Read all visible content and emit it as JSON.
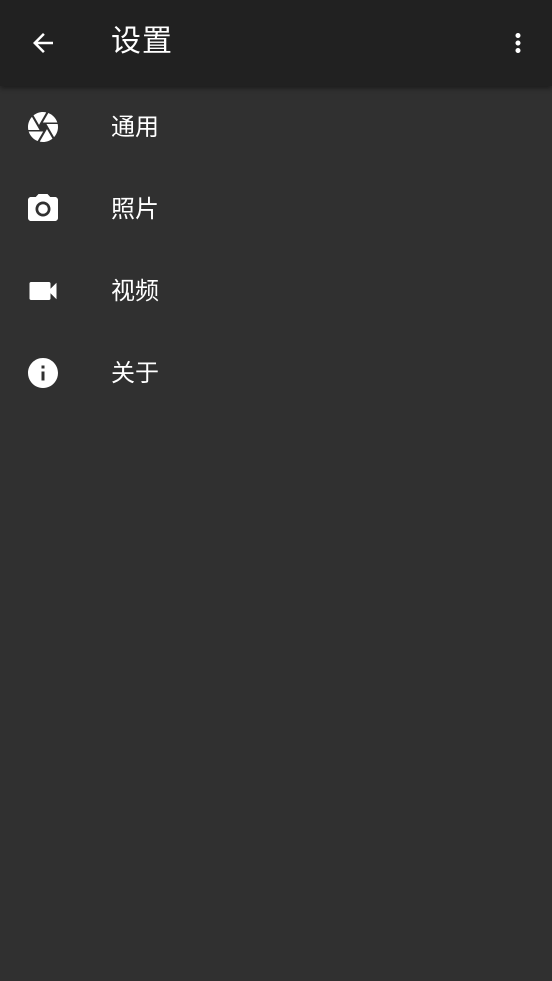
{
  "appbar": {
    "title": "设置",
    "back_icon": "arrow-back-icon",
    "overflow_icon": "more-vert-icon"
  },
  "settings": {
    "items": [
      {
        "label": "通用",
        "icon": "aperture-icon"
      },
      {
        "label": "照片",
        "icon": "camera-icon"
      },
      {
        "label": "视频",
        "icon": "videocam-icon"
      },
      {
        "label": "关于",
        "icon": "info-icon"
      }
    ]
  },
  "colors": {
    "background": "#303030",
    "appbar": "#212121",
    "foreground": "#ffffff"
  }
}
